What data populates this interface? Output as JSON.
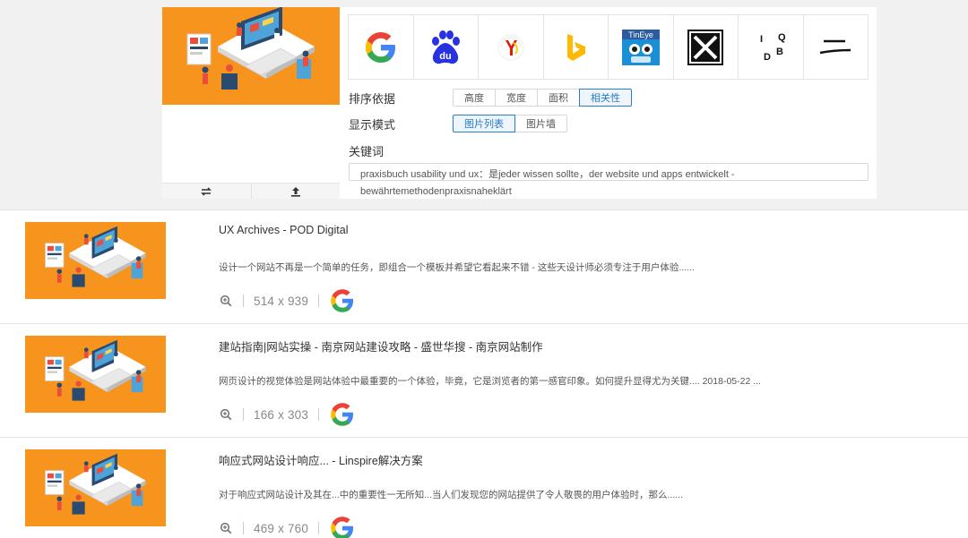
{
  "preview": {
    "actions": [
      {
        "icon": "swap-arrows-icon"
      },
      {
        "icon": "upload-icon"
      }
    ]
  },
  "engines": [
    {
      "name": "Google",
      "icon": "google-icon"
    },
    {
      "name": "Baidu",
      "icon": "baidu-icon",
      "text": "du"
    },
    {
      "name": "Yandex",
      "icon": "yandex-icon"
    },
    {
      "name": "Bing",
      "icon": "bing-icon"
    },
    {
      "name": "TinEye",
      "icon": "tineye-icon",
      "text": "TinEye"
    },
    {
      "name": "X",
      "icon": "x-box-icon"
    },
    {
      "name": "IQDB",
      "icon": "iqdb-icon",
      "letters": [
        "I",
        "Q",
        "D",
        "B"
      ]
    },
    {
      "name": "Menu",
      "icon": "equals-lines-icon"
    }
  ],
  "options": {
    "sort_label": "排序依据",
    "sort_buttons": [
      "高度",
      "宽度",
      "面积",
      "相关性"
    ],
    "sort_active": "相关性",
    "display_label": "显示模式",
    "display_buttons": [
      "图片列表",
      "图片墙"
    ],
    "display_active": "图片列表",
    "keyword_label": "关键词",
    "keyword_line1": "praxisbuch usability und ux：是jeder wissen sollte，der website und apps entwickelt -",
    "keyword_line2": "bewährtemethodenpraxisnaheklärt"
  },
  "results": [
    {
      "title": "UX Archives - POD Digital",
      "desc": "设计一个网站不再是一个简单的任务，即组合一个模板并希望它看起来不错 - 这些天设计师必须专注于用户体验......",
      "dims": "514 x 939",
      "engine_icon": "google-icon"
    },
    {
      "title": "建站指南|网站实操 - 南京网站建设攻略 - 盛世华搜 - 南京网站制作",
      "desc": "网页设计的视觉体验是网站体验中最重要的一个体验，毕竟，它是浏览者的第一感官印象。如何提升显得尤为关键.... 2018-05-22 ...",
      "dims": "166 x 303",
      "engine_icon": "google-icon"
    },
    {
      "title": "响应式网站设计响应... - Linspire解决方案",
      "desc": "对于响应式网站设计及其在...中的重要性一无所知...当人们发现您的网站提供了令人敬畏的用户体验时，那么......",
      "dims": "469 x 760",
      "engine_icon": "google-icon"
    }
  ],
  "colors": {
    "accent": "#2a7cc7",
    "thumb_bg": "#f7941d"
  }
}
